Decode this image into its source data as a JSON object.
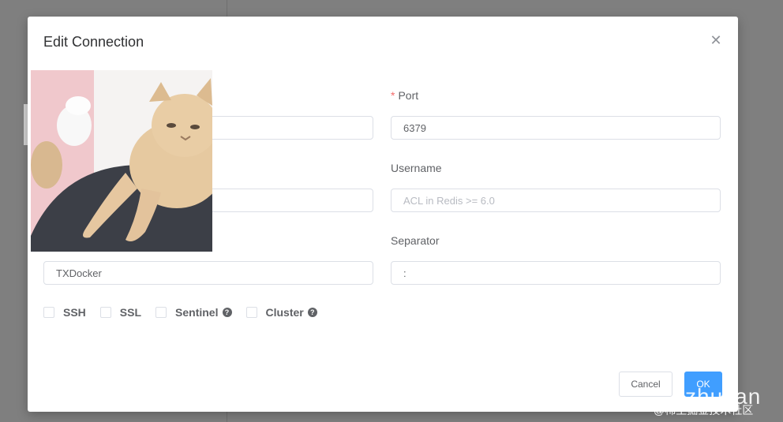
{
  "modal": {
    "title": "Edit Connection",
    "close_icon": "close-icon"
  },
  "form": {
    "port": {
      "label": "Port",
      "required_mark": "*",
      "value": "6379"
    },
    "username": {
      "label": "Username",
      "value": "",
      "placeholder": "ACL in Redis >= 6.0"
    },
    "separator": {
      "label": "Separator",
      "value": ":"
    },
    "name": {
      "value": "TXDocker"
    }
  },
  "options": [
    {
      "label": "SSH",
      "checked": false
    },
    {
      "label": "SSL",
      "checked": false
    },
    {
      "label": "Sentinel",
      "checked": false,
      "help": true
    },
    {
      "label": "Cluster",
      "checked": false,
      "help": true
    }
  ],
  "buttons": {
    "cancel": "Cancel",
    "ok": "OK"
  },
  "overlay_image": {
    "subject": "cat photo"
  },
  "watermark": {
    "large": "zhuyan",
    "small": "@稀土掘金技术社区"
  },
  "colors": {
    "primary": "#409eff",
    "required": "#f56c6c",
    "backdrop": "#7f7f7f"
  }
}
